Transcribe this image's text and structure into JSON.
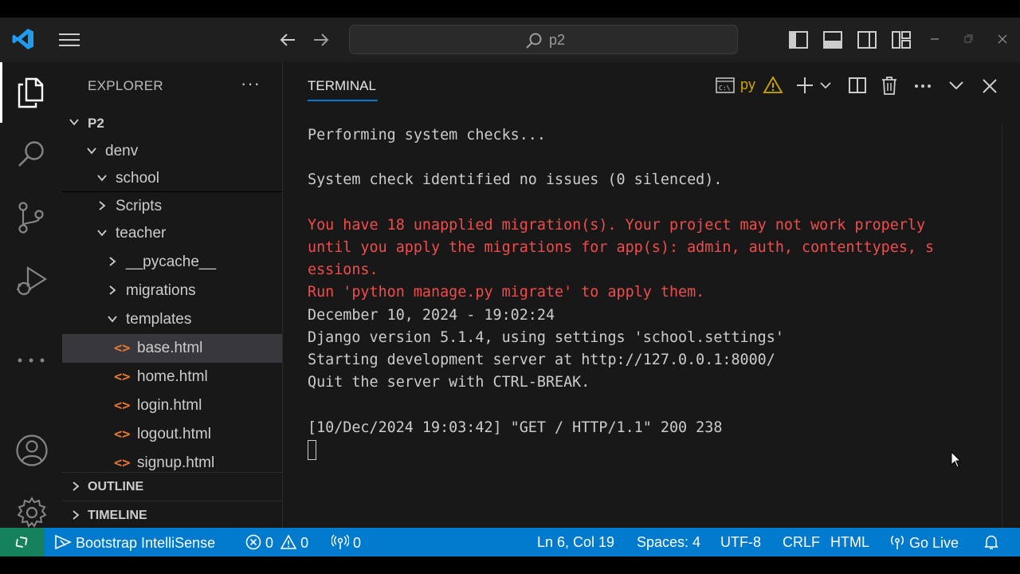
{
  "titlebar": {
    "search_text": "p2"
  },
  "sidebar": {
    "title": "EXPLORER",
    "more": "···",
    "tree": [
      {
        "label": "P2",
        "chevron": "down"
      },
      {
        "label": "denv",
        "chevron": "down"
      },
      {
        "label": "school",
        "chevron": "down"
      },
      {
        "label": "Scripts",
        "chevron": "right"
      },
      {
        "label": "teacher",
        "chevron": "down"
      },
      {
        "label": "__pycache__",
        "chevron": "right"
      },
      {
        "label": "migrations",
        "chevron": "right"
      },
      {
        "label": "templates",
        "chevron": "down"
      },
      {
        "label": "base.html"
      },
      {
        "label": "home.html"
      },
      {
        "label": "login.html"
      },
      {
        "label": "logout.html"
      },
      {
        "label": "signup.html"
      }
    ],
    "outline": "OUTLINE",
    "timeline": "TIMELINE"
  },
  "panel": {
    "tab": "TERMINAL",
    "profile": "py"
  },
  "terminal": {
    "lines": [
      {
        "text": "Performing system checks...",
        "color": "normal"
      },
      {
        "text": "",
        "color": "normal"
      },
      {
        "text": "System check identified no issues (0 silenced).",
        "color": "normal"
      },
      {
        "text": "",
        "color": "normal"
      },
      {
        "text": "You have 18 unapplied migration(s). Your project may not work properly",
        "color": "red"
      },
      {
        "text": "until you apply the migrations for app(s): admin, auth, contenttypes, s",
        "color": "red"
      },
      {
        "text": "essions.",
        "color": "red"
      },
      {
        "text": "Run 'python manage.py migrate' to apply them.",
        "color": "red"
      },
      {
        "text": "December 10, 2024 - 19:02:24",
        "color": "normal"
      },
      {
        "text": "Django version 5.1.4, using settings 'school.settings'",
        "color": "normal"
      },
      {
        "text": "Starting development server at http://127.0.0.1:8000/",
        "color": "normal"
      },
      {
        "text": "Quit the server with CTRL-BREAK.",
        "color": "normal"
      },
      {
        "text": "",
        "color": "normal"
      },
      {
        "text": "[10/Dec/2024 19:03:42] \"GET / HTTP/1.1\" 200 238",
        "color": "normal"
      }
    ]
  },
  "statusbar": {
    "bootstrap": "Bootstrap IntelliSense",
    "errors": "0",
    "warnings": "0",
    "ports": "0",
    "position": "Ln 6, Col 19",
    "spaces": "Spaces: 4",
    "encoding": "UTF-8",
    "eol": "CRLF",
    "language": "HTML",
    "golive": "Go Live"
  },
  "colors": {
    "accent": "#007acc",
    "remote": "#16825d",
    "error_text": "#f14c4c",
    "html_icon": "#e37933",
    "warning": "#cca700"
  }
}
